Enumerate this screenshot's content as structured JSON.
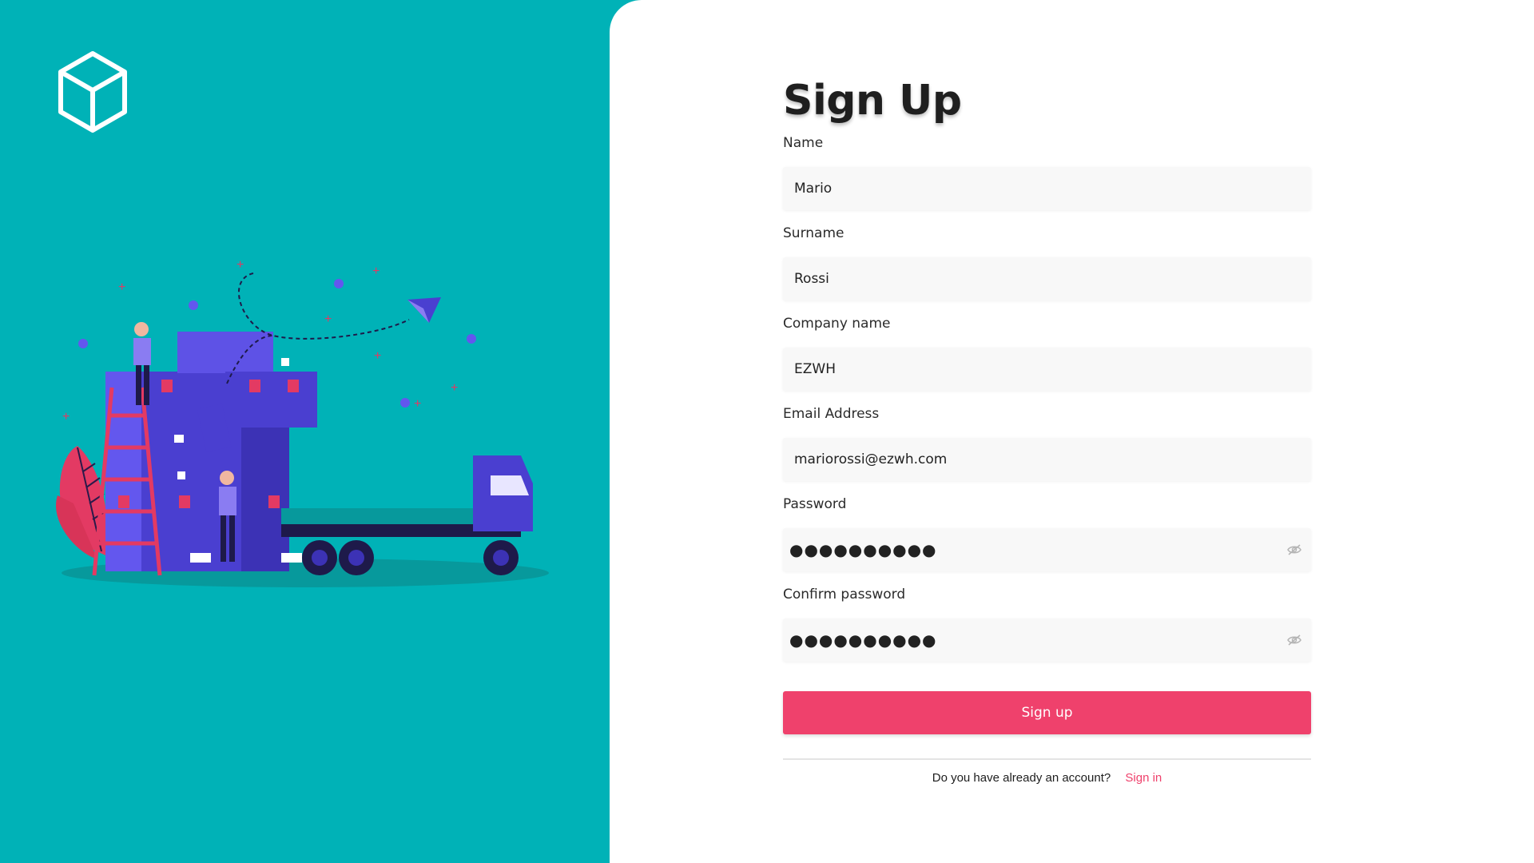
{
  "page": {
    "title": "Sign Up",
    "accent_color": "#ef416c",
    "background_color": "#00b2b7"
  },
  "brand": {
    "logo_icon": "cube-icon"
  },
  "form": {
    "name": {
      "label": "Name",
      "value": "Mario"
    },
    "surname": {
      "label": "Surname",
      "value": "Rossi"
    },
    "company": {
      "label": "Company name",
      "value": "EZWH"
    },
    "email": {
      "label": "Email Address",
      "value": "mariorossi@ezwh.com"
    },
    "password": {
      "label": "Password",
      "value": "●●●●●●●●●●",
      "toggle_icon": "eye-off-icon"
    },
    "confirm_password": {
      "label": "Confirm password",
      "value": "●●●●●●●●●●",
      "toggle_icon": "eye-off-icon"
    },
    "submit_label": "Sign up"
  },
  "footer": {
    "prompt": "Do you have already an account?",
    "link": "Sign in"
  }
}
